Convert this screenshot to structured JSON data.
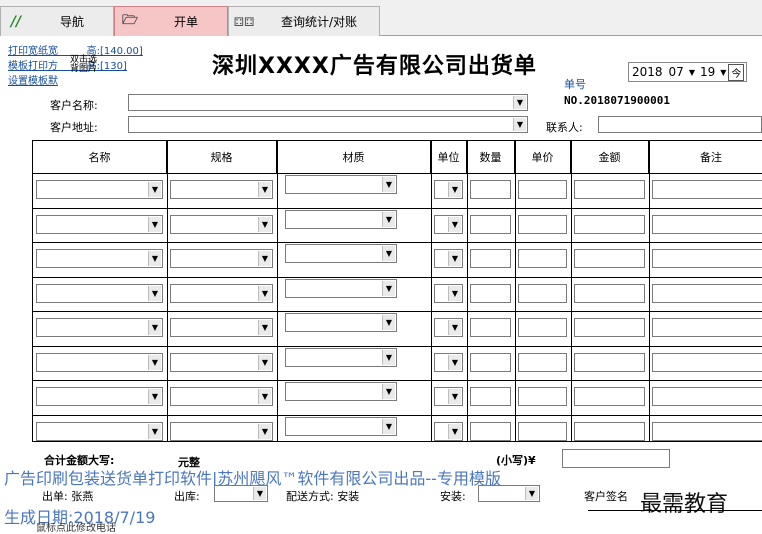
{
  "tabs": [
    {
      "label": "导航",
      "icon": "nav-icon"
    },
    {
      "label": "开单",
      "icon": "folder-open-icon"
    },
    {
      "label": "查询统计/对账",
      "icon": "binoculars-icon"
    }
  ],
  "links": {
    "print_paper_width": "打印宽纸宽",
    "paper_height": "高:[140.00]",
    "template_print": "模板打印方",
    "template_height": "高:[130]",
    "set_template": "设置模板默",
    "overlay_text_1": "双击选",
    "overlay_text_2": "背图片"
  },
  "title": "深圳XXXX广告有限公司出货单",
  "order": {
    "label": "单号",
    "number": "NO.2018071900001"
  },
  "date": {
    "year": "2018",
    "month": "07",
    "day": "19",
    "today_button": "今"
  },
  "customer": {
    "name_label": "客户名称:",
    "name_value": "",
    "address_label": "客户地址:",
    "address_value": "",
    "contact_label": "联系人:",
    "contact_value": ""
  },
  "grid": {
    "headers": [
      "名称",
      "规格",
      "材质",
      "单位",
      "数量",
      "单价",
      "金额",
      "备注"
    ],
    "row_count": 8
  },
  "totals": {
    "upper_label": "合计金额大写:",
    "upper_value": "元整",
    "lower_label": "(小写)¥",
    "lower_value": ""
  },
  "footer": {
    "issuer_label": "出单:",
    "issuer_value": "张燕",
    "warehouse_label": "出库:",
    "delivery_label": "配送方式:",
    "delivery_value": "安装",
    "install_label": "安装:",
    "sign_label": "客户签名",
    "hint": "鼠标点此修改电话"
  },
  "watermark": {
    "line1": "广告印刷包装送货单打印软件|苏州飓风™软件有限公司出品--专用模版",
    "line2": "生成日期:2018/7/19"
  },
  "brand": "最需教育",
  "colors": {
    "active_tab": "#f6c6c6",
    "link": "#1a4fa0",
    "watermark": "#2b5fb8"
  }
}
